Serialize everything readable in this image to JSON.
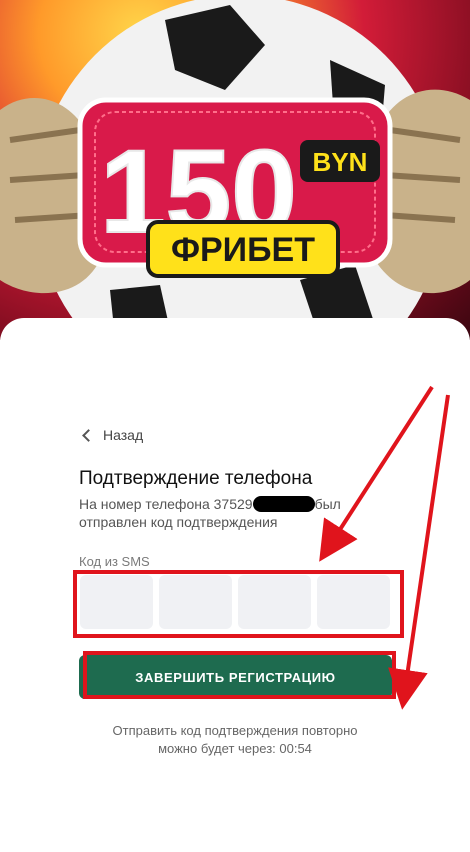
{
  "banner": {
    "amount": "150",
    "currency": "BYN",
    "label": "ФРИБЕТ"
  },
  "back_label": "Назад",
  "title": "Подтверждение телефона",
  "description": {
    "prefix": "На номер телефона 37529",
    "suffix": "был",
    "line2": "отправлен код подтверждения"
  },
  "sms_label": "Код из SMS",
  "code_digits": [
    "",
    "",
    "",
    ""
  ],
  "submit_label": "ЗАВЕРШИТЬ РЕГИСТРАЦИЮ",
  "resend": {
    "line1": "Отправить код подтверждения повторно",
    "line2": "можно будет через: 00:54"
  },
  "colors": {
    "primary": "#1e6b4f",
    "annotation": "#e0141c",
    "badge": "#d91a4a",
    "badge_yellow": "#ffe11a"
  }
}
